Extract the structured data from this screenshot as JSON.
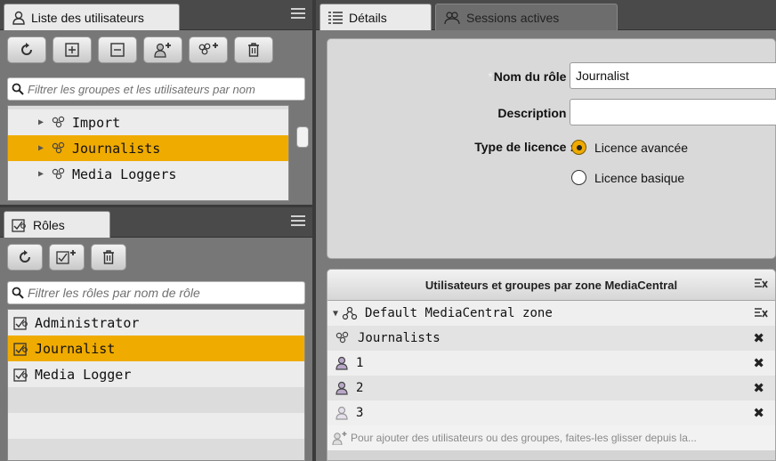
{
  "users_panel": {
    "tab_label": "Liste des utilisateurs",
    "search_placeholder": "Filtrer les groupes et les utilisateurs par nom",
    "groups": [
      {
        "label": "Import",
        "selected": false
      },
      {
        "label": "Journalists",
        "selected": true
      },
      {
        "label": "Media Loggers",
        "selected": false
      }
    ]
  },
  "roles_panel": {
    "tab_label": "Rôles",
    "search_placeholder": "Filtrer les rôles par nom de rôle",
    "roles": [
      {
        "label": "Administrator",
        "selected": false
      },
      {
        "label": "Journalist",
        "selected": true
      },
      {
        "label": "Media Logger",
        "selected": false
      }
    ]
  },
  "details_panel": {
    "tabs": [
      {
        "label": "Détails",
        "active": true
      },
      {
        "label": "Sessions actives",
        "active": false
      }
    ],
    "form": {
      "role_name_label": "Nom du rôle :",
      "role_name_value": "Journalist",
      "description_label": "Description :",
      "description_value": "",
      "license_label": "Type de licence :",
      "license_options": [
        {
          "label": "Licence avancée",
          "checked": true
        },
        {
          "label": "Licence basique",
          "checked": false
        }
      ]
    },
    "zones": {
      "header": "Utilisateurs et groupes par zone MediaCentral",
      "zone_name": "Default MediaCentral zone",
      "members": [
        {
          "label": "Journalists",
          "type": "group"
        },
        {
          "label": "1",
          "type": "user"
        },
        {
          "label": "2",
          "type": "user"
        },
        {
          "label": "3",
          "type": "user-faded"
        }
      ],
      "drop_hint": "Pour ajouter des utilisateurs ou des groupes, faites-les glisser depuis la..."
    }
  },
  "colors": {
    "selection": "#f0ab00",
    "panel_bg": "#777777",
    "header_bg": "#4a4a4a"
  }
}
